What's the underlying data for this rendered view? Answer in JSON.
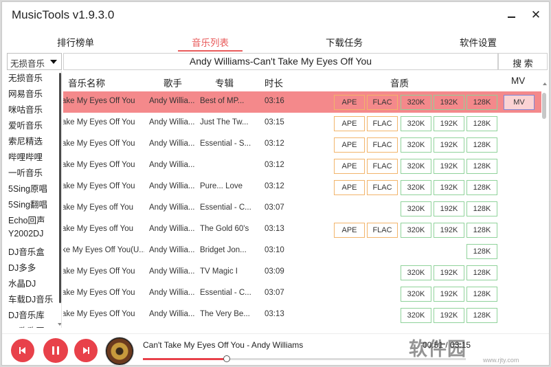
{
  "app": {
    "title": "MusicTools v1.9.3.0"
  },
  "window_controls": {
    "minimize": "",
    "close": "✕"
  },
  "tabs": [
    {
      "label": "排行榜单",
      "active": false
    },
    {
      "label": "音乐列表",
      "active": true
    },
    {
      "label": "下载任务",
      "active": false
    },
    {
      "label": "软件设置",
      "active": false
    }
  ],
  "search": {
    "source": "无损音乐",
    "query": "Andy Williams-Can't Take My Eyes Off You",
    "button": "搜 索"
  },
  "sources": [
    "无损音乐",
    "网易音乐",
    "咪咕音乐",
    "爱听音乐",
    "索尼精选",
    "哔哩哔哩",
    "一听音乐",
    "5Sing原唱",
    "5Sing翻唱",
    "Echo回声",
    "Y2002DJ",
    "DJ音乐盒",
    "DJ多多",
    "水晶DJ",
    "车载DJ音乐",
    "DJ音乐库",
    "DJ嗨嗨网"
  ],
  "columns": {
    "name": "音乐名称",
    "singer": "歌手",
    "album": "专辑",
    "duration": "时长",
    "quality": "音质",
    "mv": "MV"
  },
  "rows": [
    {
      "name": "ake My Eyes Off You",
      "singer": "Andy Willia...",
      "album": "Best of MP...",
      "duration": "03:16",
      "quality": [
        "APE",
        "FLAC",
        "320K",
        "192K",
        "128K"
      ],
      "mv": "MV",
      "selected": true
    },
    {
      "name": "ake My Eyes Off You",
      "singer": "Andy Willia...",
      "album": "Just The Tw...",
      "duration": "03:15",
      "quality": [
        "APE",
        "FLAC",
        "320K",
        "192K",
        "128K"
      ],
      "mv": "",
      "selected": false
    },
    {
      "name": "ake My Eyes Off You",
      "singer": "Andy Willia...",
      "album": "Essential - S...",
      "duration": "03:12",
      "quality": [
        "APE",
        "FLAC",
        "320K",
        "192K",
        "128K"
      ],
      "mv": "",
      "selected": false
    },
    {
      "name": "ake My Eyes Off You",
      "singer": "Andy Willia...",
      "album": "",
      "duration": "03:12",
      "quality": [
        "APE",
        "FLAC",
        "320K",
        "192K",
        "128K"
      ],
      "mv": "",
      "selected": false
    },
    {
      "name": "ake My Eyes Off You",
      "singer": "Andy Willia...",
      "album": "Pure... Love",
      "duration": "03:12",
      "quality": [
        "APE",
        "FLAC",
        "320K",
        "192K",
        "128K"
      ],
      "mv": "",
      "selected": false
    },
    {
      "name": "ake My Eyes off You",
      "singer": "Andy Willia...",
      "album": "Essential - C...",
      "duration": "03:07",
      "quality": [
        "",
        "",
        "320K",
        "192K",
        "128K"
      ],
      "mv": "",
      "selected": false
    },
    {
      "name": "ake My Eyes off You",
      "singer": "Andy Willia...",
      "album": "The Gold 60's",
      "duration": "03:13",
      "quality": [
        "APE",
        "FLAC",
        "320K",
        "192K",
        "128K"
      ],
      "mv": "",
      "selected": false
    },
    {
      "name": "ke My Eyes Off You(U...",
      "singer": "Andy Willia...",
      "album": "Bridget Jon...",
      "duration": "03:10",
      "quality": [
        "",
        "",
        "",
        "",
        "128K"
      ],
      "mv": "",
      "selected": false
    },
    {
      "name": "ake My Eyes Off You",
      "singer": "Andy Willia...",
      "album": "TV Magic I",
      "duration": "03:09",
      "quality": [
        "",
        "",
        "320K",
        "192K",
        "128K"
      ],
      "mv": "",
      "selected": false
    },
    {
      "name": "ake My Eyes Off You",
      "singer": "Andy Willia...",
      "album": "Essential - C...",
      "duration": "03:07",
      "quality": [
        "",
        "",
        "320K",
        "192K",
        "128K"
      ],
      "mv": "",
      "selected": false
    },
    {
      "name": "ake My Eyes Off You",
      "singer": "Andy Willia...",
      "album": "The Very Be...",
      "duration": "03:13",
      "quality": [
        "",
        "",
        "320K",
        "192K",
        "128K"
      ],
      "mv": "",
      "selected": false
    }
  ],
  "player": {
    "now_playing": "Can't Take My Eyes Off You - Andy Williams",
    "time": "00:51 / 03:15",
    "progress_percent": 26
  },
  "watermark": {
    "text": "软件园",
    "sub": "www.rjty.com"
  },
  "colors": {
    "accent": "#e85a5a",
    "selected_row": "#f4898b",
    "lossless_border": "#f2b46a",
    "mp3_border": "#8fd29a",
    "mv_border": "#7a86d8"
  }
}
